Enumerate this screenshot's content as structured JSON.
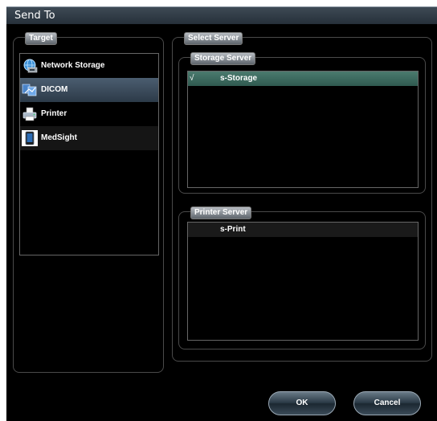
{
  "dialog": {
    "title": "Send To"
  },
  "target": {
    "legend": "Target",
    "items": [
      {
        "label": "Network Storage",
        "icon": "network-storage-icon"
      },
      {
        "label": "DICOM",
        "icon": "dicom-icon",
        "selected": true
      },
      {
        "label": "Printer",
        "icon": "printer-icon"
      },
      {
        "label": "MedSight",
        "icon": "tablet-icon"
      }
    ]
  },
  "select_server": {
    "legend": "Select Server",
    "storage": {
      "legend": "Storage Server",
      "rows": [
        {
          "check": "√",
          "name": "s-Storage",
          "selected": true
        }
      ]
    },
    "printer": {
      "legend": "Printer Server",
      "rows": [
        {
          "check": "",
          "name": "s-Print",
          "selected": false
        }
      ]
    }
  },
  "buttons": {
    "ok": "OK",
    "cancel": "Cancel"
  },
  "colors": {
    "selected_target": "#3c4e60",
    "selected_server": "#3f6b60",
    "background": "#000000"
  }
}
